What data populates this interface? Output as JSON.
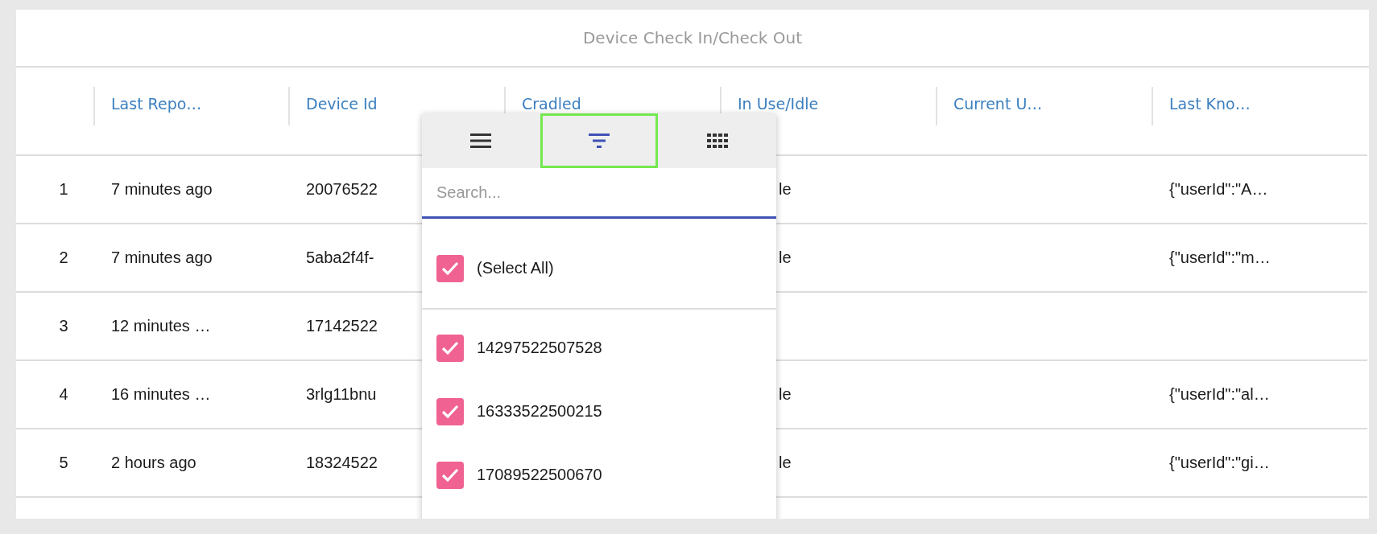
{
  "title": "Device Check In/Check Out",
  "columns": [
    "Last Repo…",
    "Device Id",
    "Cradled",
    "In Use/Idle",
    "Current U…",
    "Last Kno…"
  ],
  "rows": [
    {
      "index": "1",
      "last_reported": "7 minutes ago",
      "device_id": "20076522",
      "in_use": "le",
      "last_known": "{\"userId\":\"A…"
    },
    {
      "index": "2",
      "last_reported": "7 minutes ago",
      "device_id": "5aba2f4f-",
      "in_use": "le",
      "last_known": "{\"userId\":\"m…"
    },
    {
      "index": "3",
      "last_reported": "12 minutes …",
      "device_id": "17142522"
    },
    {
      "index": "4",
      "last_reported": "16 minutes …",
      "device_id": "3rlg11bnu",
      "in_use": "le",
      "last_known": "{\"userId\":\"al…"
    },
    {
      "index": "5",
      "last_reported": "2 hours ago",
      "device_id": "18324522",
      "in_use": "le",
      "last_known": "{\"userId\":\"gi…"
    }
  ],
  "filter_menu": {
    "tabs": [
      {
        "kind": "menu",
        "selected": false
      },
      {
        "kind": "filter",
        "selected": true
      },
      {
        "kind": "columns",
        "selected": false
      }
    ],
    "search": {
      "placeholder": "Search..."
    },
    "select_all": {
      "label": "(Select All)",
      "checked": true
    },
    "items": [
      {
        "label": "14297522507528",
        "checked": true
      },
      {
        "label": "16333522500215",
        "checked": true
      },
      {
        "label": "17089522500670",
        "checked": true
      }
    ]
  }
}
